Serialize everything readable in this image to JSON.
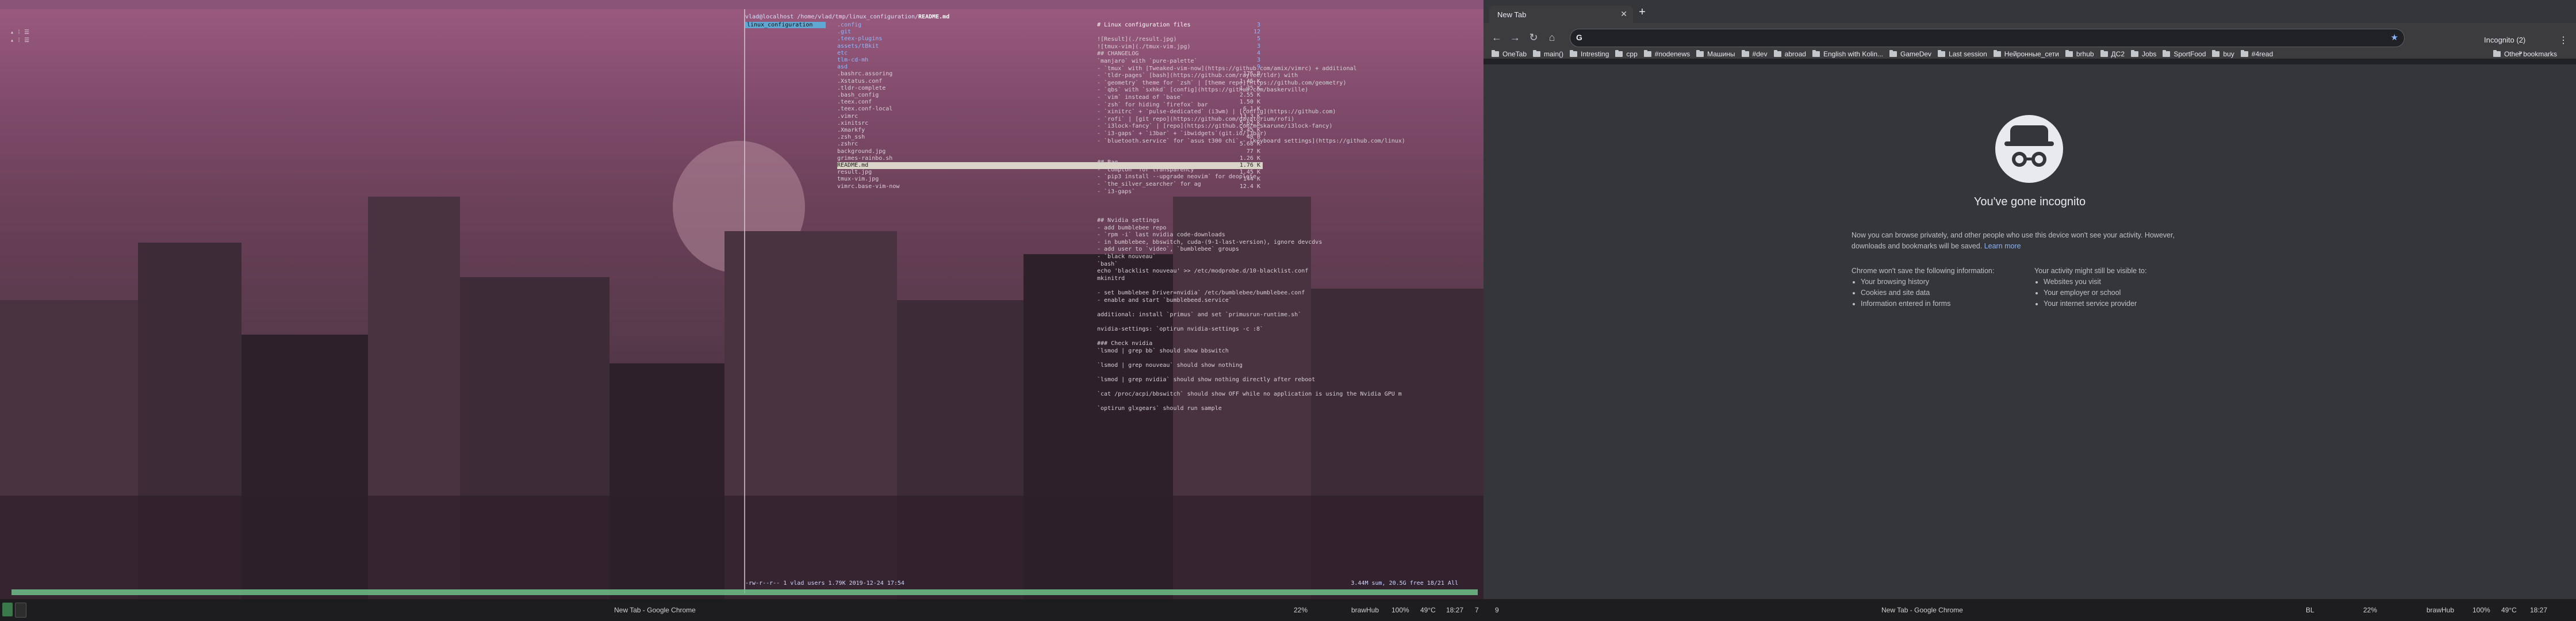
{
  "wallpaper": {
    "desc_colors": [
      "#9b5b7e",
      "#45303e"
    ]
  },
  "left_terminal": {
    "lines": [
      "▴ ⁞ ☰",
      "▴ ⁞ ☰"
    ]
  },
  "ranger": {
    "path_prefix": "vlad@localhost /home/vlad/tmp/linux_configuration/",
    "path_file": "README.md",
    "parent_items": [
      "linux_configuration"
    ],
    "files": [
      {
        "name": ".config",
        "size": "3",
        "dir": true
      },
      {
        "name": ".git",
        "size": "12",
        "dir": true
      },
      {
        "name": ".teex-plugins",
        "size": "5",
        "dir": true
      },
      {
        "name": "assets/tBkit",
        "size": "3",
        "dir": true
      },
      {
        "name": "etc",
        "size": "4",
        "dir": true
      },
      {
        "name": "tlm-cd-mh",
        "size": "3",
        "dir": true
      },
      {
        "name": "asd",
        "size": "9",
        "dir": true
      },
      {
        "name": ".bashrc.assoring",
        "size": "175 B",
        "dir": false
      },
      {
        "name": ".Xstatus.conf",
        "size": "1.45 K",
        "dir": false
      },
      {
        "name": ".tldr-complete",
        "size": "1.35 K",
        "dir": false
      },
      {
        "name": ".bash_config",
        "size": "2.55 K",
        "dir": false
      },
      {
        "name": ".teex.conf",
        "size": "1.50 K",
        "dir": false
      },
      {
        "name": ".teex.conf-local",
        "size": "6.1 K",
        "dir": false
      },
      {
        "name": ".vimrc",
        "size": "13.3 K",
        "dir": false
      },
      {
        "name": ".xinitsrc",
        "size": "5.62 K",
        "dir": false
      },
      {
        "name": ".Xmarkfy",
        "size": "3.45 K",
        "dir": false
      },
      {
        "name": ".zsh_ssh",
        "size": "48 B",
        "dir": false
      },
      {
        "name": ".zshrc",
        "size": "5.68 K",
        "dir": false
      },
      {
        "name": "background.jpg",
        "size": "77 K",
        "dir": false
      },
      {
        "name": "grimes-rainbo.sh",
        "size": "1.26 K",
        "dir": false
      },
      {
        "name": "README.md",
        "size": "1.76 K",
        "dir": false,
        "sel": true
      },
      {
        "name": "result.jpg",
        "size": "1.45 K",
        "dir": false
      },
      {
        "name": "tmux-vim.jpg",
        "size": "144 K",
        "dir": false
      },
      {
        "name": "vimrc.base-vim-now",
        "size": "12.4 K",
        "dir": false
      }
    ],
    "preview": [
      {
        "t": "# Linux configuration files",
        "h": true
      },
      {
        "t": ""
      },
      {
        "t": "![Result](./result.jpg)"
      },
      {
        "t": "![tmux-vim](./tmux-vim.jpg)"
      },
      {
        "t": "## CHANGELOG"
      },
      {
        "t": "`manjaro` with `pure-palette`"
      },
      {
        "t": "- `tmux` with [Tweaked-vim-now](https://github.com/amix/vimrc) + additional"
      },
      {
        "t": "- `tldr-pages` [bash](https://github.com/raylee/tldr) with"
      },
      {
        "t": "- `geometry` theme for `zsh` | [theme repo](https://github.com/geometry)"
      },
      {
        "t": "- `qbs` with `sxhkd` [config](https://github.com/baskerville)"
      },
      {
        "t": "- `vim` instead of `base`"
      },
      {
        "t": "- `zsh` for hiding `firefox` bar"
      },
      {
        "t": "- `xinitrc` + `pulse-dedicated` (i3wm) | [config](https://github.com)"
      },
      {
        "t": "- `rofi` | [git repo](https://github.com/davatorium/rofi)"
      },
      {
        "t": "- `i3lock-fancy` | [repo](https://github.com/meskarune/i3lock-fancy)"
      },
      {
        "t": "- `i3-gaps` + `i3bar` + `ibwidgets`(git.io/j3bar)"
      },
      {
        "t": "- `bluetooth.service` for `asus t300 chi` - [keyboard settings](https://github.com/linux)"
      },
      {
        "t": ""
      },
      {
        "t": ""
      },
      {
        "t": "## Bag"
      },
      {
        "t": "- `compton` for transparency"
      },
      {
        "t": "- `pip3 install --upgrade neovim` for deoplete"
      },
      {
        "t": "- `the_silver_searcher` for ag"
      },
      {
        "t": "- `i3-gaps`"
      },
      {
        "t": ""
      },
      {
        "t": ""
      },
      {
        "t": ""
      },
      {
        "t": "## Nvidia settings"
      },
      {
        "t": "- add bumblebee repo"
      },
      {
        "t": "- `rpm -i` last nvidia code-downloads"
      },
      {
        "t": "- in bumblebee, bbswitch, cuda-(9-1-last-version), ignore devcdvs"
      },
      {
        "t": "- add user to `video`, `bumblebee` groups"
      },
      {
        "t": "- `black nouveau`"
      },
      {
        "t": "  `bash`"
      },
      {
        "t": "echo 'blacklist nouveau' >> /etc/modprobe.d/10-blacklist.conf"
      },
      {
        "t": "mkinitrd"
      },
      {
        "t": ""
      },
      {
        "t": "- set bumblebee Driver=nvidia` /etc/bumblebee/bumblebee.conf"
      },
      {
        "t": "- enable and start `bumblebeed.service`"
      },
      {
        "t": ""
      },
      {
        "t": "additional: install `primus` and set `primusrun-runtime.sh`"
      },
      {
        "t": ""
      },
      {
        "t": "nvidia-settings: `optirun nvidia-settings -c :8`"
      },
      {
        "t": ""
      },
      {
        "t": "### Check nvidia"
      },
      {
        "t": "`lsmod | grep bb` should show bbswitch"
      },
      {
        "t": ""
      },
      {
        "t": "`lsmod | grep nouveau` should show nothing"
      },
      {
        "t": ""
      },
      {
        "t": "`lsmod | grep nvidia` should show nothing directly after reboot"
      },
      {
        "t": ""
      },
      {
        "t": "`cat /proc/acpi/bbswitch` should show OFF while no application is using the Nvidia GPU m"
      },
      {
        "t": ""
      },
      {
        "t": "`optirun glxgears` should run sample"
      }
    ],
    "status_left": "-rw-r--r-- 1 vlad users 1.79K 2019-12-24 17:54",
    "status_right": "3.44M sum, 20.5G free  18/21  All"
  },
  "chrome": {
    "tab_title": "New Tab",
    "incognito_label": "Incognito (2)",
    "omnibox_placeholder": "",
    "bookmarks": [
      "OneTab",
      "main()",
      "Intresting",
      "cpp",
      "#nodenews",
      "Машины",
      "#dev",
      "abroad",
      "English with Kolin...",
      "GameDev",
      "Last session",
      "Нейронные_сети",
      "brhub",
      "ДС2",
      "Jobs",
      "SportFood",
      "buy",
      "#4read"
    ],
    "bookmarks_other": "Other bookmarks",
    "heading": "You've gone incognito",
    "para1": "Now you can browse privately, and other people who use this device won't see your activity. However, downloads and bookmarks will be saved.",
    "learn_more": "Learn more",
    "wont_save_title": "Chrome won't save the following information:",
    "wont_save": [
      "Your browsing history",
      "Cookies and site data",
      "Information entered in forms"
    ],
    "visible_title": "Your activity might still be visible to:",
    "visible": [
      "Websites you visit",
      "Your employer or school",
      "Your internet service provider"
    ]
  },
  "taskbar": {
    "left_title": "New Tab - Google Chrome",
    "right_title": "New Tab - Google Chrome",
    "left_stats": [
      "22%",
      "brawHub",
      "100%",
      "49°C",
      "18:27",
      "7",
      "9"
    ],
    "right_stats": [
      "BL",
      "22%",
      "brawHub",
      "100%",
      "49°C",
      "18:27"
    ]
  }
}
